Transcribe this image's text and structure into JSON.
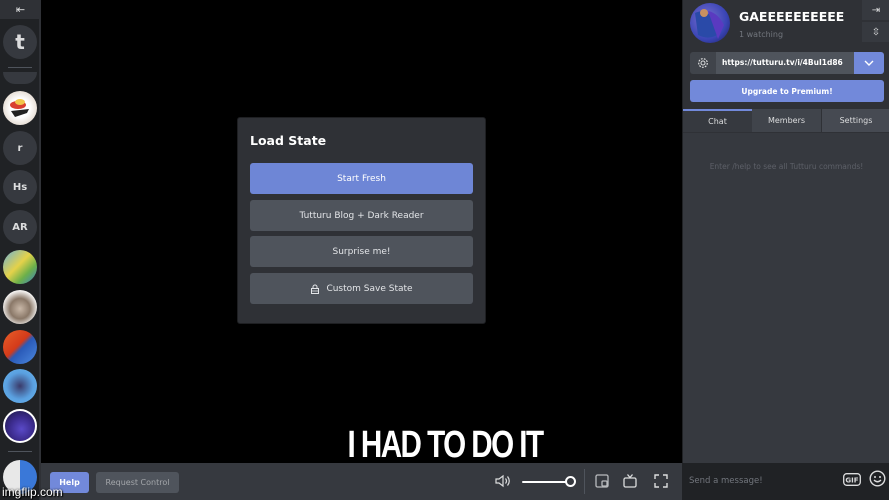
{
  "rail": {
    "collapse_icon": "collapse-left-icon",
    "servers": [
      {
        "label": "t",
        "kind": "letter"
      },
      {
        "label": "",
        "kind": "image",
        "desc": "anime-avatar"
      },
      {
        "label": "r",
        "kind": "letter"
      },
      {
        "label": "Hs",
        "kind": "letter"
      },
      {
        "label": "AR",
        "kind": "letter"
      },
      {
        "label": "",
        "kind": "image",
        "desc": "spongebob-avatar"
      },
      {
        "label": "",
        "kind": "image",
        "desc": "hedgehog-avatar"
      },
      {
        "label": "",
        "kind": "image",
        "desc": "yin-yang-avatar"
      },
      {
        "label": "",
        "kind": "image",
        "desc": "cat-avatar"
      },
      {
        "label": "",
        "kind": "image",
        "desc": "purple-avatar"
      },
      {
        "label": "",
        "kind": "image",
        "desc": "cartoon-avatar"
      }
    ]
  },
  "modal": {
    "title": "Load State",
    "options": [
      {
        "label": "Start Fresh",
        "primary": true
      },
      {
        "label": "Tutturu Blog + Dark Reader",
        "primary": false
      },
      {
        "label": "Surprise me!",
        "primary": false
      },
      {
        "label": "Custom Save State",
        "primary": false,
        "icon": "lock-icon"
      }
    ]
  },
  "controls": {
    "help_label": "Help",
    "request_control_label": "Request Control",
    "volume": 1.0
  },
  "overlay": {
    "caption": "I HAD TO DO IT",
    "watermark": "imgflip.com"
  },
  "room": {
    "title": "GAEEEEEEEEEE",
    "watching": "1 watching",
    "url": "https://tutturu.tv/i/4BuI1d86",
    "premium_label": "Upgrade to Premium!",
    "tabs": [
      "Chat",
      "Members",
      "Settings"
    ],
    "active_tab": "Chat",
    "chat_hint": "Enter /help to see all Tutturu commands!",
    "message_placeholder": "Send a message!",
    "gif_label": "GIF"
  },
  "colors": {
    "accent": "#7289da",
    "panel": "#2f3136",
    "chat_bg": "#36393f",
    "rail": "#202225"
  }
}
